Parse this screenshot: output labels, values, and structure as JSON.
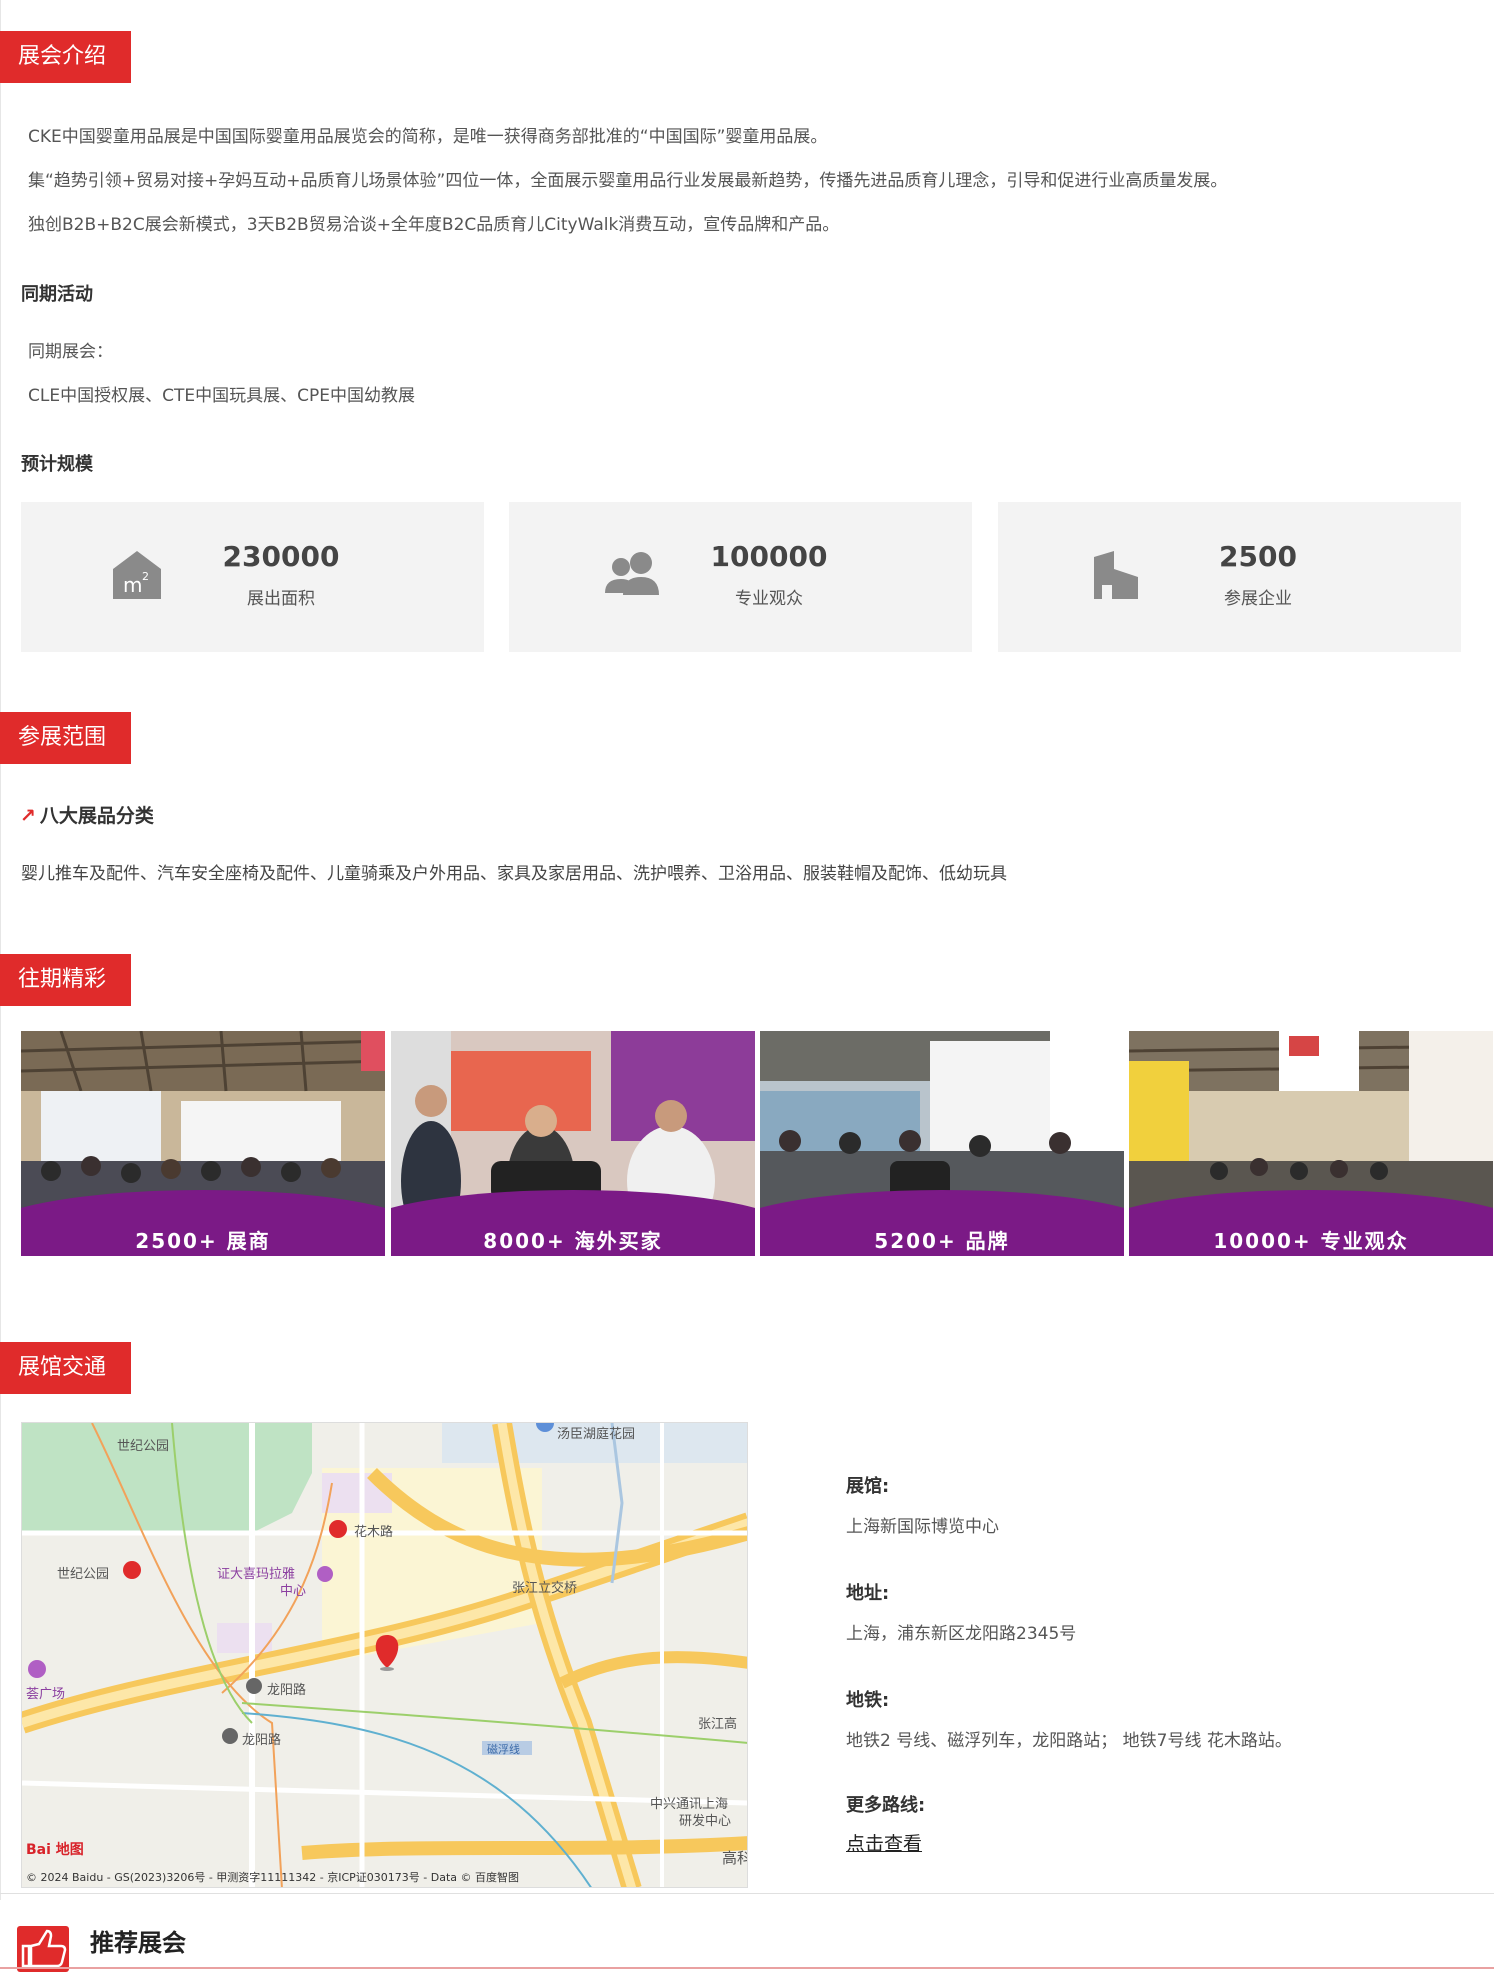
{
  "sections": {
    "intro": "展会介绍",
    "scope": "参展范围",
    "past": "往期精彩",
    "transport": "展馆交通"
  },
  "intro": {
    "lines": [
      "CKE中国婴童用品展是中国国际婴童用品展览会的简称，是唯一获得商务部批准的“中国国际”婴童用品展。",
      "集“趋势引领+贸易对接+孕妈互动+品质育儿场景体验”四位一体，全面展示婴童用品行业发展最新趋势，传播先进品质育儿理念，引导和促进行业高质量发展。",
      "独创B2B+B2C展会新模式，3天B2B贸易洽谈+全年度B2C品质育儿CityWalk消费互动，宣传品牌和产品。"
    ]
  },
  "concurrent": {
    "heading": "同期活动",
    "label": "同期展会：",
    "list": "CLE中国授权展、CTE中国玩具展、CPE中国幼教展"
  },
  "scale": {
    "heading": "预计规模",
    "stats": [
      {
        "icon": "area-icon",
        "value": "230000",
        "label": "展出面积"
      },
      {
        "icon": "audience-icon",
        "value": "100000",
        "label": "专业观众"
      },
      {
        "icon": "company-icon",
        "value": "2500",
        "label": "参展企业"
      }
    ]
  },
  "categories": {
    "arrow": "↗",
    "heading": "八大展品分类",
    "text": "婴儿推车及配件、汽车安全座椅及配件、儿童骑乘及户外用品、家具及家居用品、洗护喂养、卫浴用品、服装鞋帽及配饰、低幼玩具"
  },
  "highlights": [
    {
      "caption": "2500+ 展商"
    },
    {
      "caption": "8000+ 海外买家"
    },
    {
      "caption": "5200+ 品牌"
    },
    {
      "caption": "10000+ 专业观众"
    }
  ],
  "map": {
    "labels": {
      "century_park_top": "世纪公园",
      "huamu_road": "花木路",
      "century_park_station": "世纪公园",
      "mall": "证大喜玛拉雅",
      "mall_line2": "中心",
      "zhangjiang_bridge": "张江立交桥",
      "longyang_road_1": "龙阳路",
      "longyang_road_2": "龙阳路",
      "plaza": "荟广场",
      "maglev": "磁浮线",
      "zhangjiang": "张江高",
      "zte_line1": "中兴通讯上海",
      "zte_line2": "研发中心",
      "gao": "高科",
      "garden": "汤臣湖庭花园",
      "baidu_logo": "Bai 地图"
    },
    "copyright": "© 2024 Baidu - GS(2023)3206号 - 甲测资字11111342 - 京ICP证030173号 - Data © 百度智图"
  },
  "venue": {
    "hall_label": "展馆:",
    "hall_value": "上海新国际博览中心",
    "address_label": "地址:",
    "address_value": "上海，浦东新区龙阳路2345号",
    "metro_label": "地铁:",
    "metro_value": "地铁2 号线、磁浮列车，龙阳路站；  地铁7号线 花木路站。",
    "more_label": "更多路线:",
    "more_link": "点击查看"
  },
  "recommend": {
    "title": "推荐展会"
  },
  "colors": {
    "accent": "#e02b2b",
    "purple_band": "#7b1a86",
    "card_bg": "#f3f3f3"
  }
}
